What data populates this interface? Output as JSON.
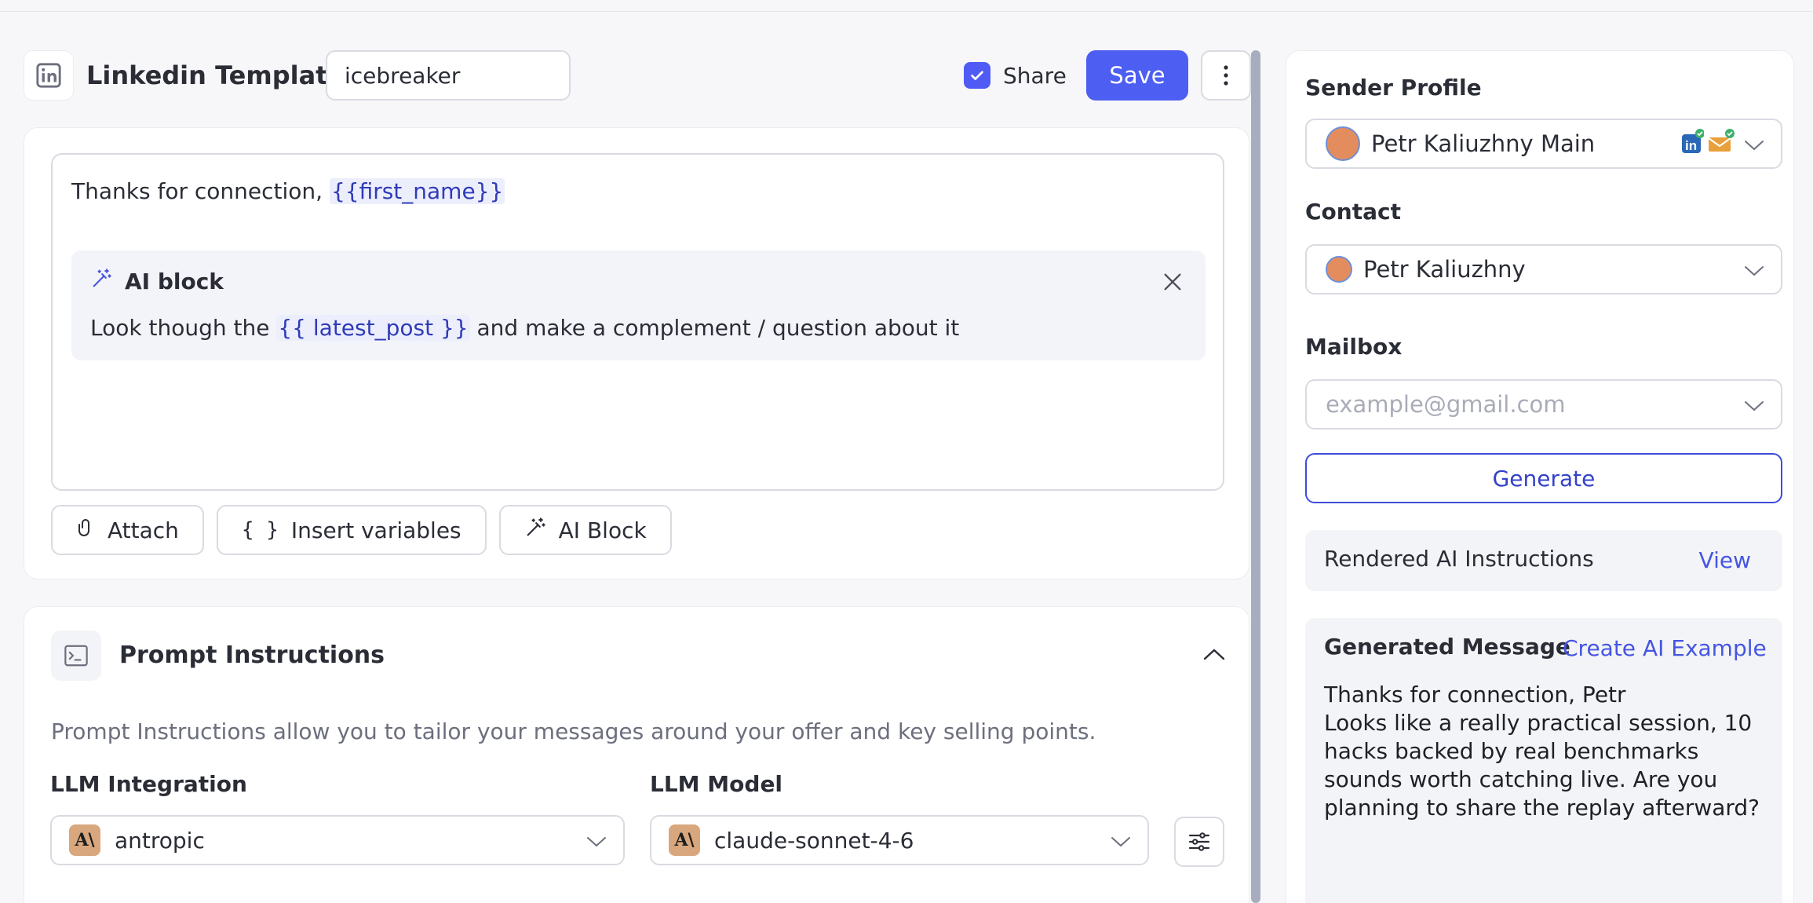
{
  "header": {
    "title": "Linkedin Template",
    "template_name": "icebreaker",
    "share_label": "Share",
    "share_checked": true,
    "save_label": "Save"
  },
  "editor": {
    "line1_prefix": "Thanks for connection, ",
    "line1_var": "{{first_name}}",
    "ai_block": {
      "title": "AI block",
      "text_prefix": "Look though the ",
      "text_var": "{{ latest_post }}",
      "text_suffix": " and make a complement / question about it"
    }
  },
  "toolbar": {
    "attach_label": "Attach",
    "insert_variables_label": "Insert variables",
    "ai_block_label": "AI Block"
  },
  "prompt": {
    "title": "Prompt Instructions",
    "description": "Prompt Instructions allow you to tailor your messages around your offer and key selling points.",
    "llm_integration_label": "LLM Integration",
    "llm_integration_value": "antropic",
    "llm_model_label": "LLM Model",
    "llm_model_value": "claude-sonnet-4-6"
  },
  "sidebar": {
    "sender_profile_label": "Sender Profile",
    "sender_profile_value": "Petr Kaliuzhny Main",
    "contact_label": "Contact",
    "contact_value": "Petr Kaliuzhny",
    "mailbox_label": "Mailbox",
    "mailbox_placeholder": "example@gmail.com",
    "generate_label": "Generate",
    "rendered_label": "Rendered AI Instructions",
    "view_label": "View",
    "generated_label": "Generated Message",
    "create_example_label": "Create AI Example",
    "generated_message": "Thanks for connection, Petr\nLooks like a really practical session, 10 hacks backed by real benchmarks sounds worth catching live. Are you planning to share the replay afterward?"
  },
  "colors": {
    "primary": "#4d5ef2",
    "variable_bg": "#eceefc",
    "variable_text": "#2f3bb7",
    "brand_icon": "#d8a77e"
  }
}
